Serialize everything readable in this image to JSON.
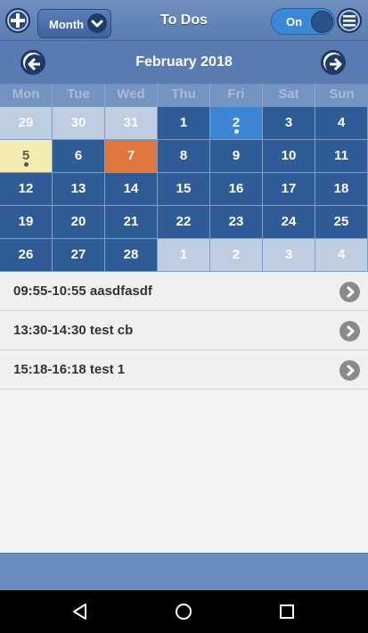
{
  "header": {
    "title": "To Dos",
    "view_select": "Month",
    "toggle_label": "On",
    "icons": {
      "add": "plus-icon",
      "menu": "hamburger-icon",
      "dropdown": "chevron-down-icon"
    }
  },
  "calendar": {
    "month_title": "February 2018",
    "weekdays": [
      "Mon",
      "Tue",
      "Wed",
      "Thu",
      "Fri",
      "Sat",
      "Sun"
    ],
    "days": [
      {
        "n": "29",
        "k": "other prev"
      },
      {
        "n": "30",
        "k": "other prev"
      },
      {
        "n": "31",
        "k": "other prev"
      },
      {
        "n": "1",
        "k": ""
      },
      {
        "n": "2",
        "k": "selected",
        "dot": true
      },
      {
        "n": "3",
        "k": ""
      },
      {
        "n": "4",
        "k": ""
      },
      {
        "n": "5",
        "k": "pastday",
        "dot": true
      },
      {
        "n": "6",
        "k": ""
      },
      {
        "n": "7",
        "k": "today"
      },
      {
        "n": "8",
        "k": ""
      },
      {
        "n": "9",
        "k": ""
      },
      {
        "n": "10",
        "k": ""
      },
      {
        "n": "11",
        "k": ""
      },
      {
        "n": "12",
        "k": ""
      },
      {
        "n": "13",
        "k": ""
      },
      {
        "n": "14",
        "k": ""
      },
      {
        "n": "15",
        "k": ""
      },
      {
        "n": "16",
        "k": ""
      },
      {
        "n": "17",
        "k": ""
      },
      {
        "n": "18",
        "k": ""
      },
      {
        "n": "19",
        "k": ""
      },
      {
        "n": "20",
        "k": ""
      },
      {
        "n": "21",
        "k": ""
      },
      {
        "n": "22",
        "k": ""
      },
      {
        "n": "23",
        "k": ""
      },
      {
        "n": "24",
        "k": ""
      },
      {
        "n": "25",
        "k": ""
      },
      {
        "n": "26",
        "k": ""
      },
      {
        "n": "27",
        "k": ""
      },
      {
        "n": "28",
        "k": ""
      },
      {
        "n": "1",
        "k": "other"
      },
      {
        "n": "2",
        "k": "other"
      },
      {
        "n": "3",
        "k": "other"
      },
      {
        "n": "4",
        "k": "other"
      }
    ],
    "colors": {
      "day": "#2f5b97",
      "other_month": "#bfcde0",
      "selected": "#3c86d3",
      "today": "#e0753d",
      "marked": "#f5ecb0"
    }
  },
  "events": [
    {
      "label": "09:55-10:55 aasdfasdf"
    },
    {
      "label": "13:30-14:30 test cb"
    },
    {
      "label": "15:18-16:18 test 1"
    }
  ],
  "system_nav": [
    "back-icon",
    "home-icon",
    "recents-icon"
  ]
}
